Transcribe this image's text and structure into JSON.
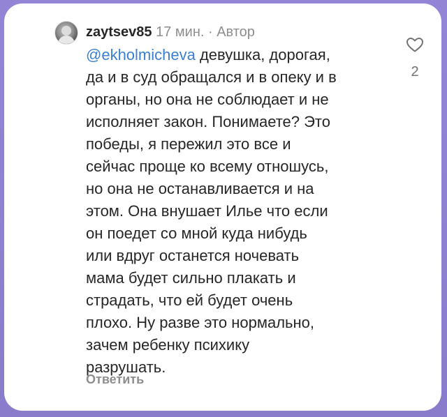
{
  "comment": {
    "username": "zaytsev85",
    "time": "17 мин.",
    "separator": "·",
    "author_badge": "Автор",
    "mention": "@ekholmicheva",
    "first_line_rest": " девушка, дорогая,",
    "lines": [
      "да и в суд обращался и в опеку и в",
      "органы, но она не соблюдает и не",
      "исполняет закон. Понимаете? Это",
      "победы, я пережил это все и",
      "сейчас проще ко всему отношусь,",
      "но она не останавливается и на",
      "этом. Она внушает Илье что если",
      "он поедет со мной куда нибудь",
      "или вдруг останется ночевать",
      "мама будет сильно плакать и",
      "страдать, что ей будет очень",
      "плохо. Ну разве это нормально,",
      "зачем ребенку психику",
      "разрушать."
    ],
    "reply_label": "Ответить",
    "like_count": "2",
    "like_icon": "heart-outline-icon",
    "avatar_icon": "user-avatar"
  },
  "colors": {
    "background": "#8f7fcf",
    "card": "#ffffff",
    "text": "#262626",
    "muted": "#8e8e8e",
    "mention": "#3b7fd1"
  }
}
